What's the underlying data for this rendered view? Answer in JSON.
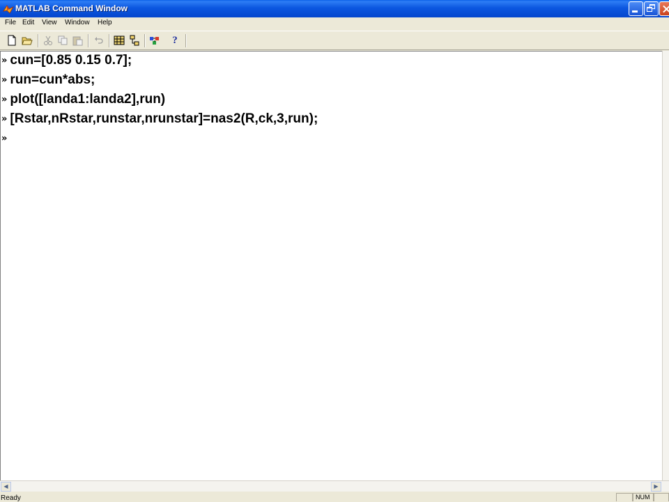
{
  "window": {
    "title": "MATLAB Command Window"
  },
  "menu": {
    "file": "File",
    "edit": "Edit",
    "view": "View",
    "window": "Window",
    "help": "Help"
  },
  "toolbar": {
    "icons": [
      "new-file-icon",
      "open-folder-icon",
      "cut-icon",
      "copy-icon",
      "paste-icon",
      "undo-icon",
      "workspace-browser-icon",
      "path-browser-icon",
      "simulink-icon",
      "help-icon"
    ],
    "help_glyph": "?"
  },
  "command_window": {
    "prompt": "»",
    "lines": [
      "cun=[0.85 0.15 0.7];",
      "run=cun*abs;",
      "plot([landa1:landa2],run)",
      "[Rstar,nRstar,runstar,nrunstar]=nas2(R,ck,3,run);",
      ""
    ]
  },
  "status": {
    "text": "Ready",
    "num": "NUM"
  }
}
